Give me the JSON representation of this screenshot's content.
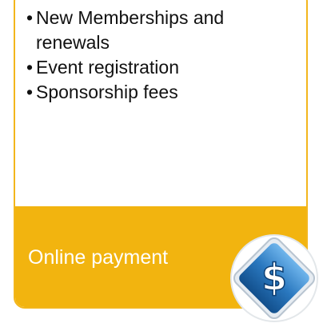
{
  "list": {
    "items": [
      "New Memberships and renewals",
      "Event registration",
      "Sponsorship fees"
    ],
    "bullet": "•"
  },
  "footer": {
    "label": "Online payment",
    "background_color": "#f2b40f",
    "text_color": "#ffffff"
  },
  "badge": {
    "icon": "dollar-sign-icon",
    "symbol": "$",
    "colors": {
      "diamond": "#1f66a8",
      "diamond_light": "#5aa6e2",
      "border": "#d0d8e0"
    }
  },
  "card": {
    "border_color": "#f3b61c"
  }
}
